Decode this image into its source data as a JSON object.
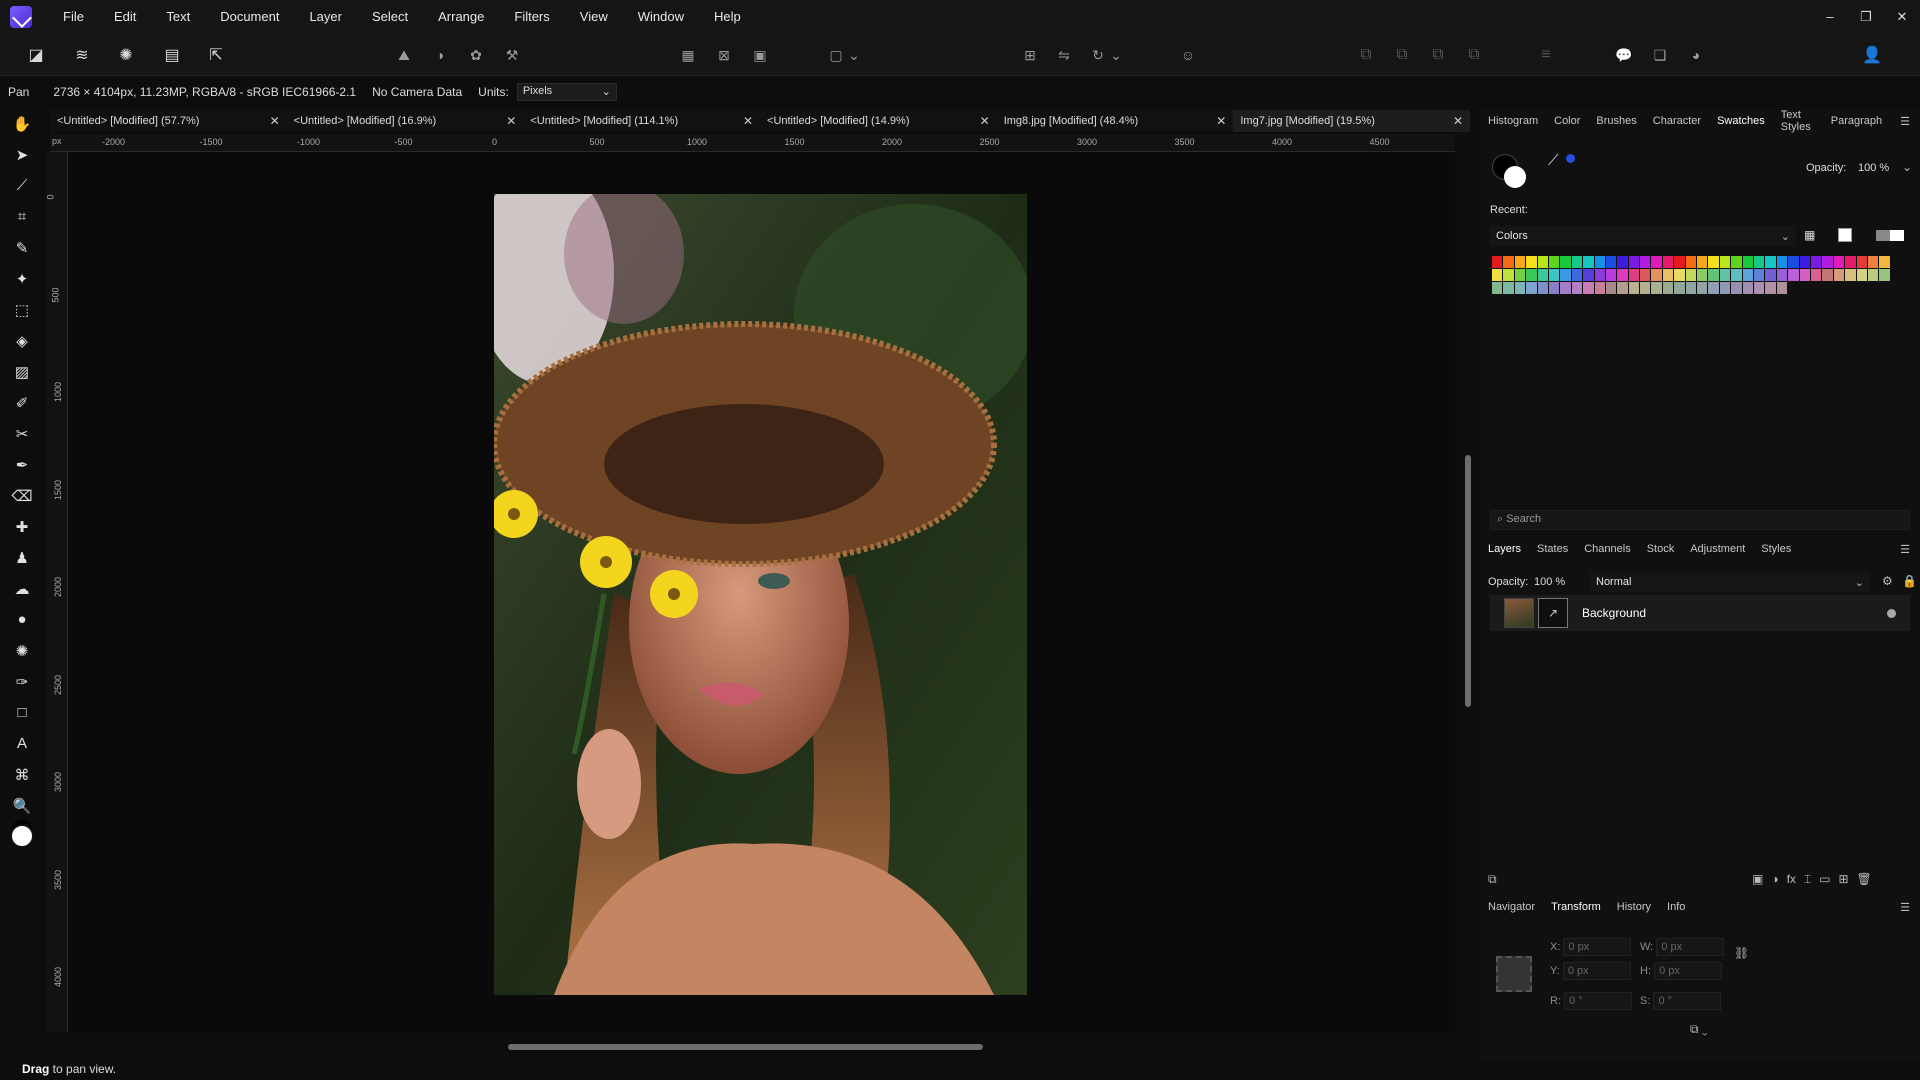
{
  "app": {
    "name": "Affinity Photo"
  },
  "menu": [
    "File",
    "Edit",
    "Text",
    "Document",
    "Layer",
    "Select",
    "Arrange",
    "Filters",
    "View",
    "Window",
    "Help"
  ],
  "window_controls": [
    "–",
    "❐",
    "✕"
  ],
  "context": {
    "tool": "Pan",
    "doc_info": "2736 × 4104px, 11.23MP, RGBA/8 - sRGB IEC61966-2.1",
    "camera": "No Camera Data",
    "units_label": "Units:",
    "units_value": "Pixels"
  },
  "tabs": [
    {
      "label": "<Untitled> [Modified] (57.7%)"
    },
    {
      "label": "<Untitled> [Modified] (16.9%)"
    },
    {
      "label": "<Untitled> [Modified] (114.1%)"
    },
    {
      "label": "<Untitled> [Modified] (14.9%)"
    },
    {
      "label": "Img8.jpg [Modified] (48.4%)"
    },
    {
      "label": "Img7.jpg [Modified] (19.5%)"
    }
  ],
  "ruler": {
    "unit": "px",
    "h_ticks": [
      "-2000",
      "-1500",
      "-1000",
      "-500",
      "0",
      "500",
      "1000",
      "1500",
      "2000",
      "2500",
      "3000",
      "3500",
      "4000",
      "4500"
    ],
    "v_ticks": [
      "0",
      "500",
      "1000",
      "1500",
      "2000",
      "2500",
      "3000",
      "3500",
      "4000"
    ]
  },
  "top_panel": {
    "tabs": [
      "Histogram",
      "Color",
      "Brushes",
      "Character",
      "Swatches",
      "Text Styles",
      "Paragraph"
    ],
    "active_tab": "Swatches",
    "opacity_label": "Opacity:",
    "opacity_value": "100 %",
    "recent_label": "Recent:",
    "palette_name": "Colors",
    "search_placeholder": "Search"
  },
  "swatch_colors": [
    "#e6191d",
    "#f36b13",
    "#f7a81b",
    "#f5e11b",
    "#b8e51b",
    "#5fd41c",
    "#17c93b",
    "#16c989",
    "#14c7c4",
    "#1591e8",
    "#1a4ee3",
    "#3b1ce0",
    "#7a1be0",
    "#b21ce0",
    "#e01cb8",
    "#e61b6a",
    "#e6191d",
    "#f36b13",
    "#f7a81b",
    "#f5e11b",
    "#b8e51b",
    "#5fd41c",
    "#17c93b",
    "#16c989",
    "#14c7c4",
    "#1591e8",
    "#1a4ee3",
    "#3b1ce0",
    "#7a1be0",
    "#b21ce0",
    "#e01cb8",
    "#e61b6a",
    "#e03c3c",
    "#f0803b",
    "#f3b640",
    "#efe03f",
    "#bfe13f",
    "#76d140",
    "#3dc85a",
    "#3cc89a",
    "#3ac5c5",
    "#3b9ae3",
    "#3d69df",
    "#573ddc",
    "#8a3cdc",
    "#b93cdc",
    "#dc3cbd",
    "#e03c80",
    "#d95a5a",
    "#e69160",
    "#eabf64",
    "#e6db63",
    "#c3d863",
    "#8bcc64",
    "#62c277",
    "#61c2a6",
    "#5fbfc0",
    "#5fa3dc",
    "#6080d8",
    "#725fd6",
    "#9860d6",
    "#bb5fd6",
    "#d55fbf",
    "#d9608f",
    "#c47575",
    "#d49c7d",
    "#d8c07f",
    "#d4cf7e",
    "#bccc7e",
    "#99c17f",
    "#80b98b",
    "#7eb9a6",
    "#7db6b6",
    "#7ea3cd",
    "#7e8fca",
    "#8b7ec8",
    "#a27ec8",
    "#b57ec8",
    "#c77eb6",
    "#c77e98",
    "#a88989",
    "#b49e8f",
    "#b8b290",
    "#b4b190",
    "#a9b290",
    "#9daa91",
    "#92a69a",
    "#91a6a4",
    "#90a4a4",
    "#909fb4",
    "#9099b2",
    "#9890b1",
    "#a290b1",
    "#ac90b1",
    "#b290a6",
    "#b29098"
  ],
  "layers_panel": {
    "tabs": [
      "Layers",
      "States",
      "Channels",
      "Stock",
      "Adjustment",
      "Styles"
    ],
    "active_tab": "Layers",
    "opacity_label": "Opacity:",
    "opacity_value": "100 %",
    "blend_mode": "Normal",
    "layer_name": "Background"
  },
  "bottom_panel": {
    "tabs": [
      "Navigator",
      "Transform",
      "History",
      "Info"
    ],
    "active_tab": "Transform",
    "fields": {
      "x_label": "X:",
      "x": "0 px",
      "w_label": "W:",
      "w": "0 px",
      "y_label": "Y:",
      "y": "0 px",
      "h_label": "H:",
      "h": "0 px",
      "r_label": "R:",
      "r": "0 °",
      "s_label": "S:",
      "s": "0 °"
    }
  },
  "status": {
    "bold": "Drag",
    "rest": " to pan view."
  }
}
